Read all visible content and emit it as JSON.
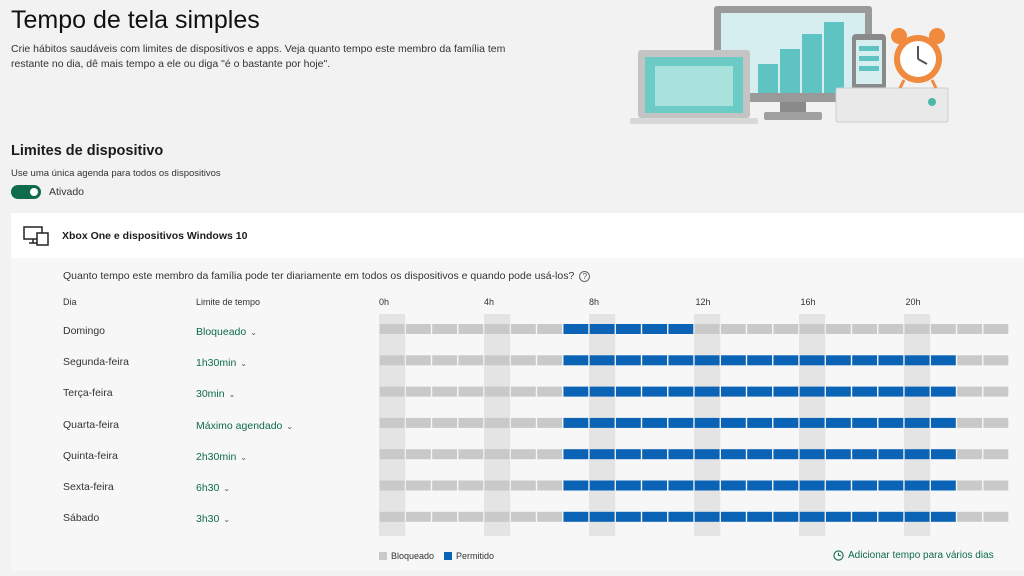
{
  "header": {
    "title": "Tempo de tela simples",
    "description": "Crie hábitos saudáveis com limites de dispositivos e apps. Veja quanto tempo este membro da família tem restante no dia, dê mais tempo a ele ou diga \"é o bastante por hoje\".",
    "illustration_icon": "devices-alarm-illustration"
  },
  "device_limits": {
    "title": "Limites de dispositivo",
    "schedule_text": "Use uma única agenda para todos os dispositivos",
    "toggle_on": true,
    "toggle_label": "Ativado"
  },
  "device": {
    "icon": "devices-icon",
    "name": "Xbox One e dispositivos Windows 10"
  },
  "schedule": {
    "question": "Quanto tempo este membro da família pode ter diariamente em todos os dispositivos e quando pode usá-los?",
    "help_icon": "help-icon",
    "col_day": "Dia",
    "col_limit": "Limite de tempo",
    "hour_labels": [
      "0h",
      "4h",
      "8h",
      "12h",
      "16h",
      "20h"
    ],
    "days": [
      {
        "day": "Domingo",
        "limit": "Bloqueado",
        "allowed": [
          7,
          12
        ]
      },
      {
        "day": "Segunda-feira",
        "limit": "1h30min",
        "allowed": [
          7,
          22
        ]
      },
      {
        "day": "Terça-feira",
        "limit": "30min",
        "allowed": [
          7,
          22
        ]
      },
      {
        "day": "Quarta-feira",
        "limit": "Máximo agendado",
        "allowed": [
          7,
          22
        ]
      },
      {
        "day": "Quinta-feira",
        "limit": "2h30min",
        "allowed": [
          7,
          22
        ]
      },
      {
        "day": "Sexta-feira",
        "limit": "6h30",
        "allowed": [
          7,
          22
        ]
      },
      {
        "day": "Sábado",
        "limit": "3h30",
        "allowed": [
          7,
          22
        ]
      }
    ],
    "legend": {
      "blocked": "Bloqueado",
      "allowed": "Permitido"
    },
    "add_link": "Adicionar tempo para vários dias"
  },
  "colors": {
    "accent": "#0e6b4c",
    "allowed": "#0a63b4",
    "blocked": "#c9c9c9",
    "stripe": "#e4e4e4"
  }
}
